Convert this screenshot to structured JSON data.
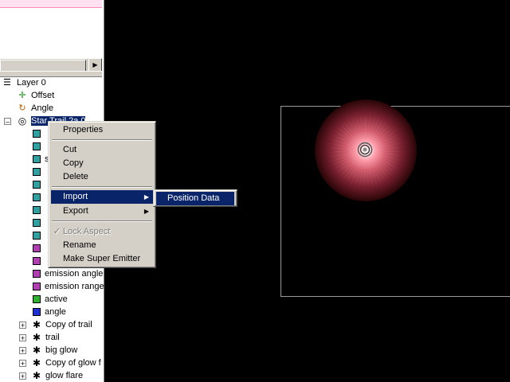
{
  "tree": {
    "top_items": [
      {
        "label": "Layer 0",
        "icon": "layer-icon"
      },
      {
        "label": "Offset",
        "icon": "move-icon"
      },
      {
        "label": "Angle",
        "icon": "angle-icon"
      },
      {
        "label": "Star Trail 2a 0",
        "icon": "emitter-icon"
      }
    ],
    "property_rows": [
      {
        "label": "",
        "color": "teal"
      },
      {
        "label": "",
        "color": "teal"
      },
      {
        "label": "s",
        "color": "teal"
      },
      {
        "label": "",
        "color": "teal"
      },
      {
        "label": "",
        "color": "teal"
      },
      {
        "label": "",
        "color": "teal"
      },
      {
        "label": "",
        "color": "teal"
      },
      {
        "label": "",
        "color": "teal"
      },
      {
        "label": "",
        "color": "teal"
      },
      {
        "label": "",
        "color": "purple"
      },
      {
        "label": "",
        "color": "purple"
      },
      {
        "label": "emission angle",
        "color": "purple"
      },
      {
        "label": "emission range",
        "color": "purple"
      },
      {
        "label": "active",
        "color": "green"
      },
      {
        "label": "angle",
        "color": "blue"
      }
    ],
    "child_emitters": [
      "Copy of trail",
      "trail",
      "big glow",
      "Copy of glow f",
      "glow flare"
    ]
  },
  "context_menu": {
    "properties": "Properties",
    "cut": "Cut",
    "copy": "Copy",
    "delete": "Delete",
    "import": "Import",
    "export": "Export",
    "lock_aspect": "Lock Aspect",
    "rename": "Rename",
    "make_super_emitter": "Make Super Emitter"
  },
  "submenu": {
    "position_data": "Position Data"
  },
  "colors": {
    "menu_bg": "#d4d0c8",
    "highlight": "#0a246a",
    "viewport_bg": "#000000",
    "glow": "#d05a6a"
  }
}
